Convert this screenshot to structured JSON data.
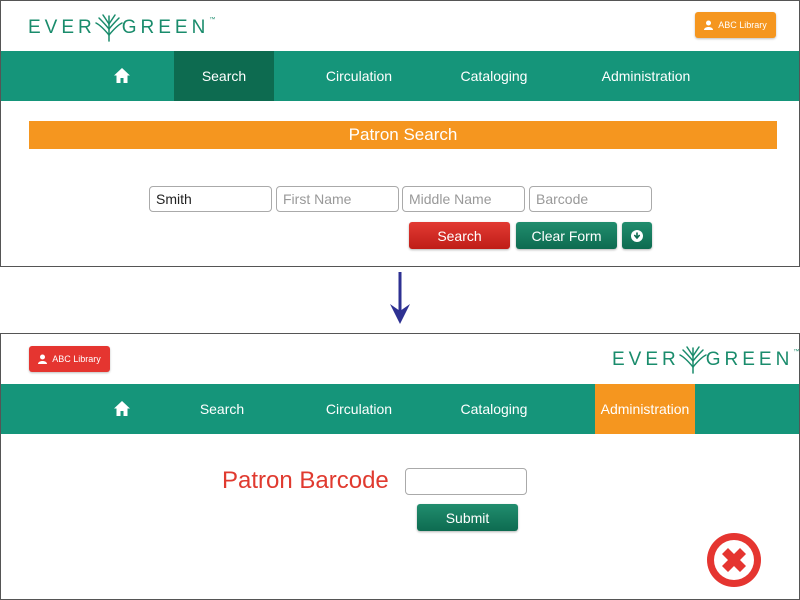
{
  "logo": {
    "text_left": "EVER",
    "text_right": "GREEN",
    "trademark": "™"
  },
  "library_button": {
    "label": "ABC Library"
  },
  "nav": {
    "items": [
      {
        "label": "Search"
      },
      {
        "label": "Circulation"
      },
      {
        "label": "Cataloging"
      },
      {
        "label": "Administration"
      }
    ]
  },
  "top_screen": {
    "banner": "Patron Search",
    "fields": {
      "last_name_value": "Smith",
      "first_name_placeholder": "First Name",
      "middle_name_placeholder": "Middle Name",
      "barcode_placeholder": "Barcode"
    },
    "buttons": {
      "search": "Search",
      "clear_form": "Clear Form"
    }
  },
  "bottom_screen": {
    "patron_barcode_label": "Patron Barcode",
    "submit": "Submit"
  },
  "colors": {
    "nav_green": "#15957a",
    "active_tab_dark": "#0d6b50",
    "active_tab_orange": "#f5961f",
    "library_orange": "#f5961f",
    "library_red": "#e53530",
    "error_red": "#e03a2f"
  },
  "icons": {
    "home": "home-icon",
    "user": "user-icon",
    "advanced": "arrow-circle-down-icon",
    "transition": "arrow-down-icon",
    "error": "x-mark-icon"
  }
}
